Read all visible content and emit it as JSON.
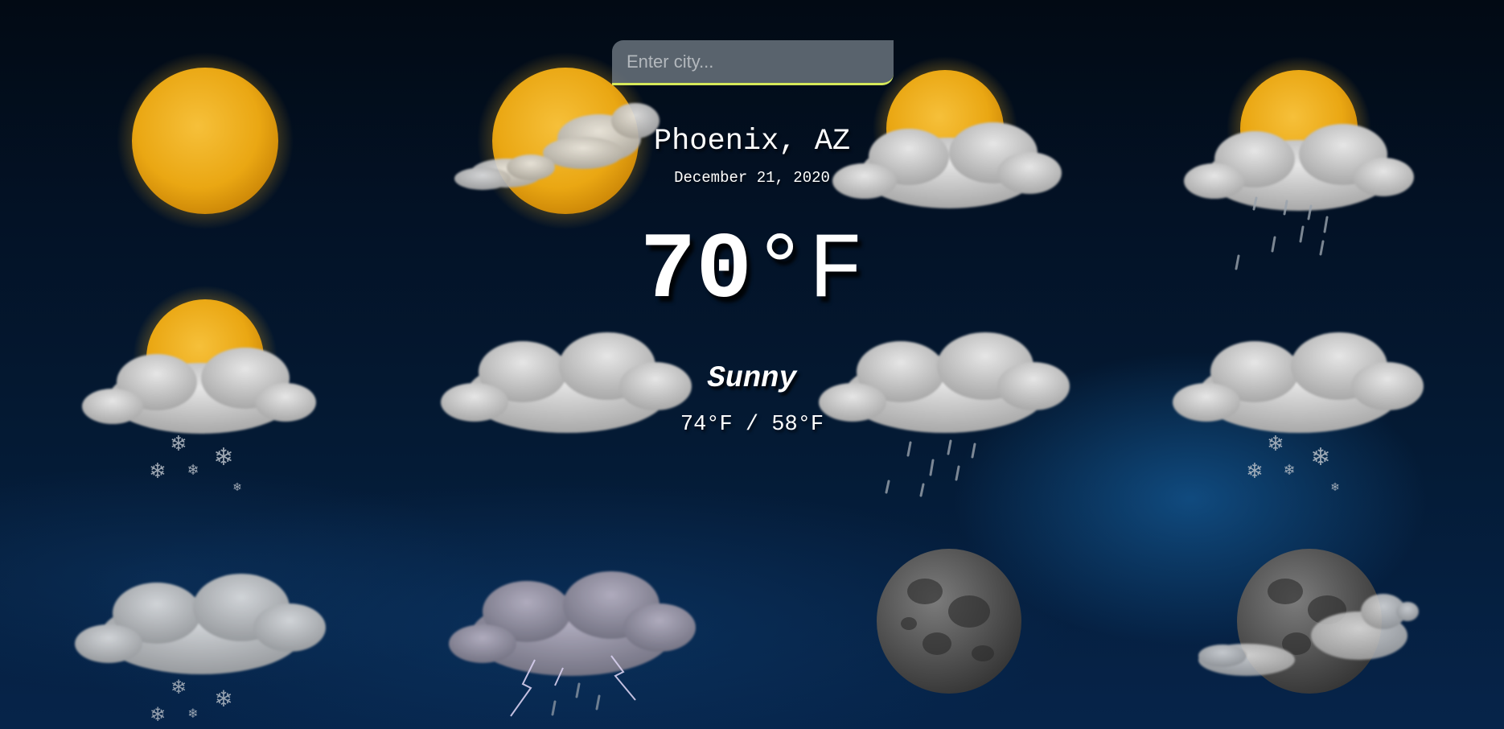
{
  "search": {
    "placeholder": "Enter city..."
  },
  "weather": {
    "city": "Phoenix, AZ",
    "date": "December 21, 2020",
    "temp_value": "70",
    "temp_unit": "°F",
    "condition": "Sunny",
    "range": "74°F / 58°F"
  },
  "background_icons": [
    "sun-icon",
    "sun-cloud-icon",
    "sun-cloud-icon",
    "sun-cloud-rain-icon",
    "sun-cloud-snow-icon",
    "cloud-icon",
    "cloud-rain-icon",
    "cloud-snow-icon",
    "cloud-snow-icon",
    "thunderstorm-icon",
    "moon-icon",
    "moon-cloud-icon"
  ],
  "colors": {
    "accent_underline": "#d6e85a",
    "sun": "#f2b01e",
    "background_dark": "#020a14",
    "background_glow": "#145a96"
  }
}
